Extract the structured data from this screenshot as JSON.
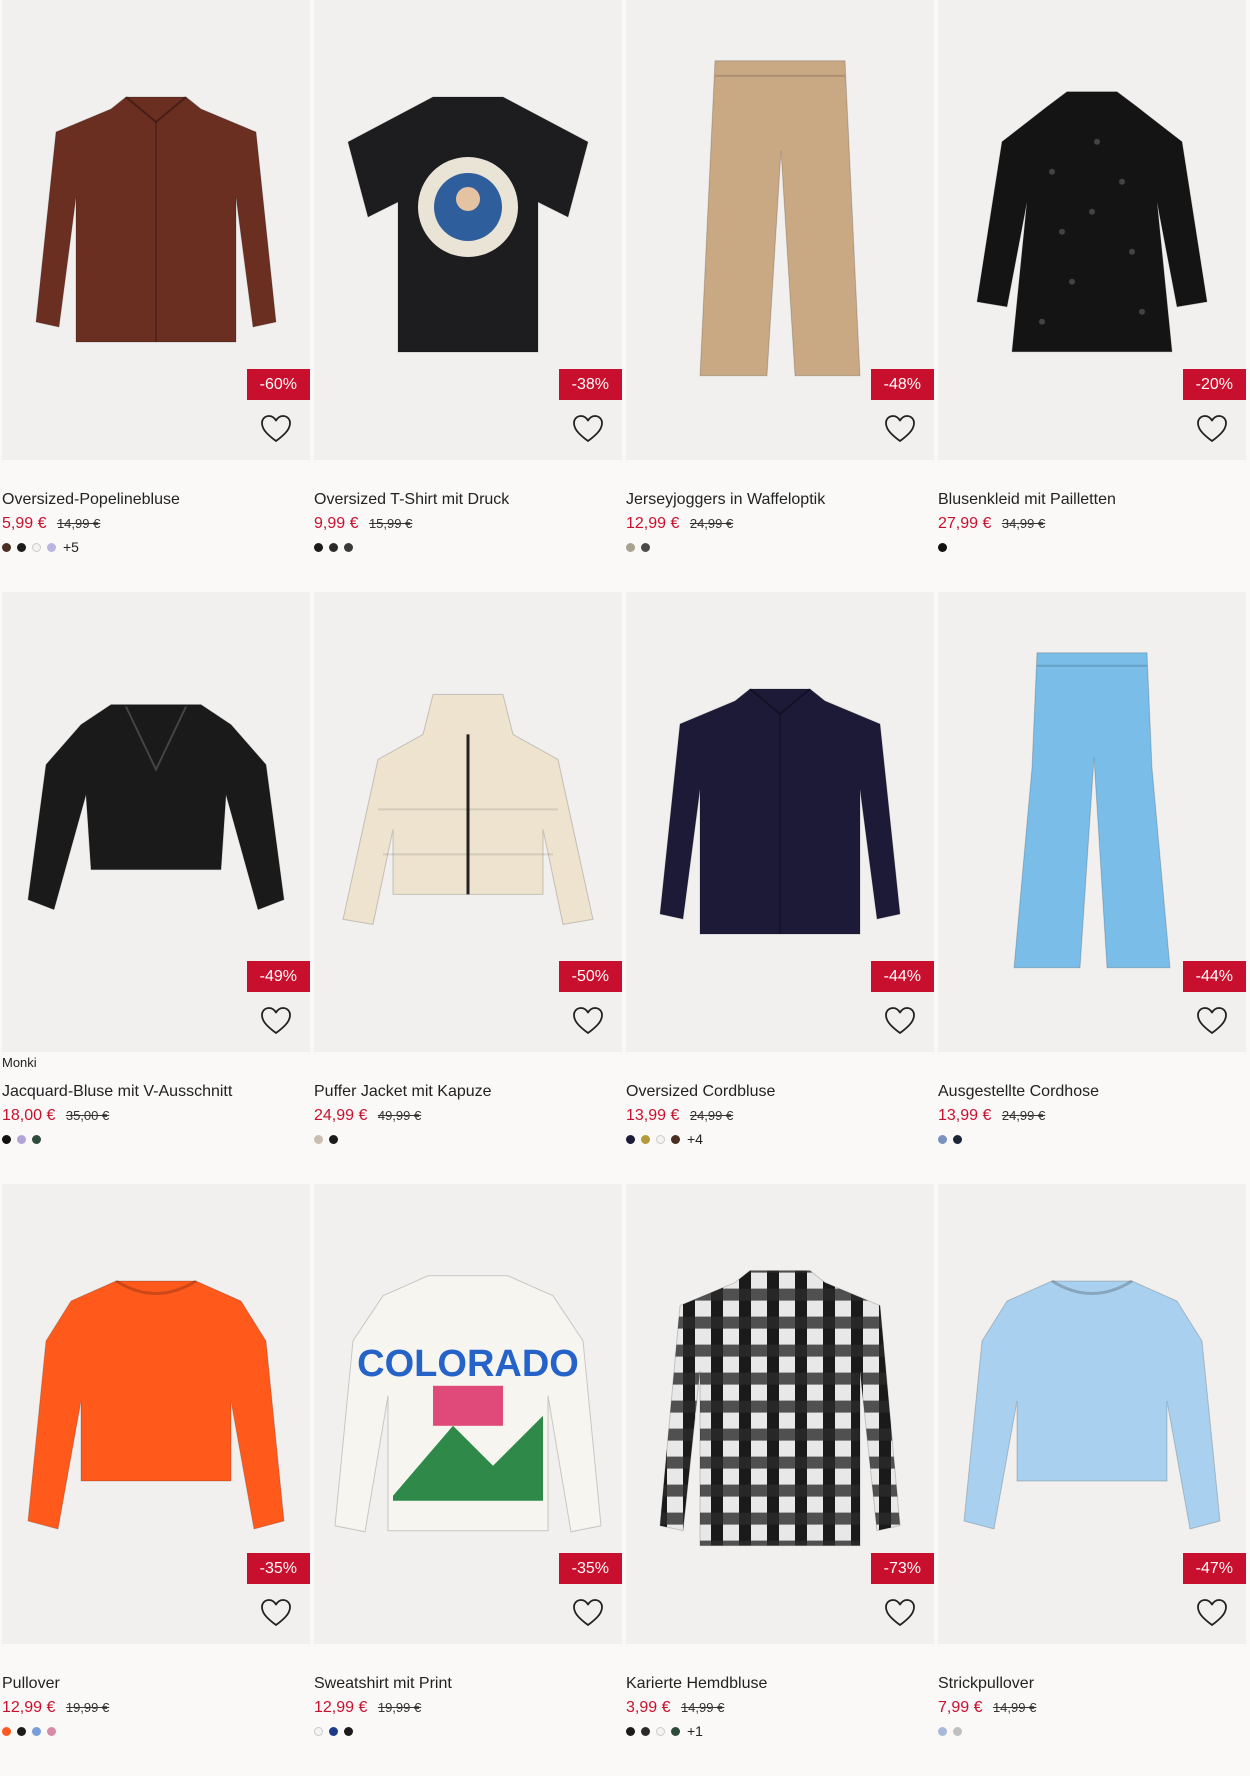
{
  "products": [
    {
      "name": "Oversized-Popelinebluse",
      "price": "5,99 €",
      "old_price": "14,99 €",
      "discount": "-60%",
      "swatches": [
        "#4a2e22",
        "#1b1b1b",
        "#f3f3f3",
        "#b9b5e0"
      ],
      "more": "+5",
      "garment": "shirt",
      "color": "#6b2f22"
    },
    {
      "name": "Oversized T-Shirt mit Druck",
      "price": "9,99 €",
      "old_price": "15,99 €",
      "discount": "-38%",
      "swatches": [
        "#1b1b1b",
        "#2a2a2a",
        "#3a3a3a"
      ],
      "more": "",
      "garment": "tshirt",
      "color": "#1d1d1f"
    },
    {
      "name": "Jerseyjoggers in Waffeloptik",
      "price": "12,99 €",
      "old_price": "24,99 €",
      "discount": "-48%",
      "swatches": [
        "#a8a28e",
        "#4a4a4a"
      ],
      "more": "",
      "garment": "pants",
      "color": "#c9a884"
    },
    {
      "name": "Blusenkleid mit Pailletten",
      "price": "27,99 €",
      "old_price": "34,99 €",
      "discount": "-20%",
      "swatches": [
        "#111111"
      ],
      "more": "",
      "garment": "dress",
      "color": "#141414"
    },
    {
      "brand": "Monki",
      "name": "Jacquard-Bluse mit V-Ausschnitt",
      "price": "18,00 €",
      "old_price": "35,00 €",
      "discount": "-49%",
      "swatches": [
        "#111111",
        "#b3a4d8",
        "#2e4a3a"
      ],
      "more": "",
      "garment": "blouse",
      "color": "#1a1a1a"
    },
    {
      "name": "Puffer Jacket mit Kapuze",
      "price": "24,99 €",
      "old_price": "49,99 €",
      "discount": "-50%",
      "swatches": [
        "#c9bfae",
        "#1b1b1b"
      ],
      "more": "",
      "garment": "jacket",
      "color": "#ede3cf"
    },
    {
      "name": "Oversized Cordbluse",
      "price": "13,99 €",
      "old_price": "24,99 €",
      "discount": "-44%",
      "swatches": [
        "#1c1c3a",
        "#b39b3a",
        "#f3f3f3",
        "#4a2e22"
      ],
      "more": "+4",
      "garment": "shirt",
      "color": "#1d1a38"
    },
    {
      "name": "Ausgestellte Cordhose",
      "price": "13,99 €",
      "old_price": "24,99 €",
      "discount": "-44%",
      "swatches": [
        "#7a92c0",
        "#1c2438"
      ],
      "more": "",
      "garment": "flare",
      "color": "#79bde8"
    },
    {
      "name": "Pullover",
      "price": "12,99 €",
      "old_price": "19,99 €",
      "discount": "-35%",
      "swatches": [
        "#ff5a1f",
        "#1b1b1b",
        "#7a9ed8",
        "#d98aa8"
      ],
      "more": "",
      "garment": "sweater",
      "color": "#ff5a1c"
    },
    {
      "name": "Sweatshirt mit Print",
      "price": "12,99 €",
      "old_price": "19,99 €",
      "discount": "-35%",
      "swatches": [
        "#f3f3f3",
        "#1e3a8a",
        "#1b1b1b"
      ],
      "more": "",
      "garment": "sweatshirt",
      "color": "#f7f5f0"
    },
    {
      "name": "Karierte Hemdbluse",
      "price": "3,99 €",
      "old_price": "14,99 €",
      "discount": "-73%",
      "swatches": [
        "#1b1b1b",
        "#2a2a2a",
        "#f3f3f3",
        "#2e4a3a"
      ],
      "more": "+1",
      "garment": "plaid",
      "color": "#2a2a2a"
    },
    {
      "name": "Strickpullover",
      "price": "7,99 €",
      "old_price": "14,99 €",
      "discount": "-47%",
      "swatches": [
        "#a9b8d8",
        "#c0c0c0"
      ],
      "more": "",
      "garment": "sweater",
      "color": "#a9d0ee"
    }
  ]
}
